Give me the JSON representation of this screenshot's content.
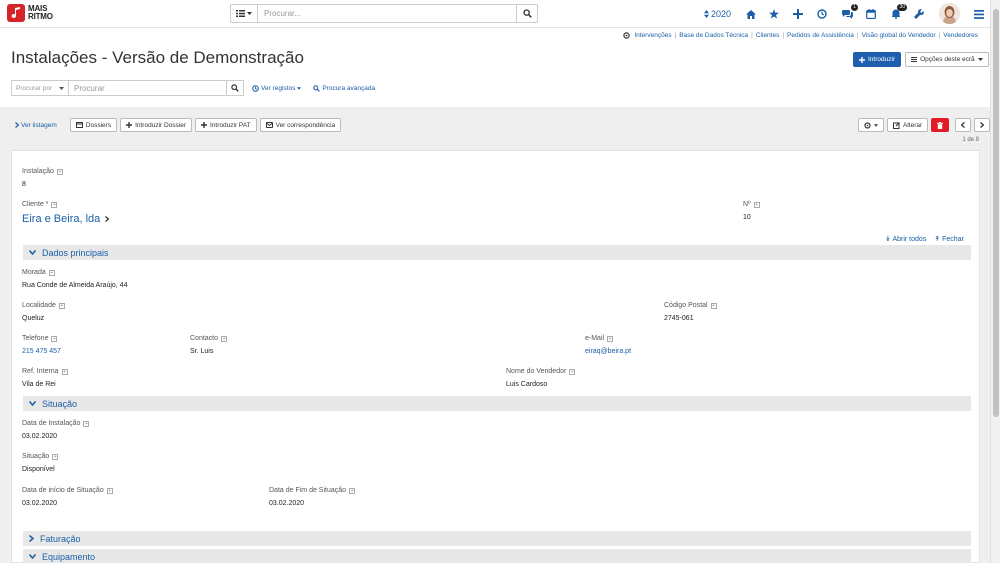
{
  "app": {
    "logo_line1": "MAIS",
    "logo_line2": "RITMO"
  },
  "search": {
    "placeholder": "Procurar..."
  },
  "topbar": {
    "year": "2020",
    "badge_support": "1",
    "badge_notifications": "30"
  },
  "quicklinks": [
    "Intervenções",
    "Base de Dados Técnica",
    "Clientes",
    "Pedidos de Assistência",
    "Visão global do Vendedor",
    "Vendedores"
  ],
  "page": {
    "title": "Instalações - Versão de Demonstração",
    "introduce_label": "Introduzir",
    "options_label": "Opções deste ecrã"
  },
  "filter": {
    "search_by": "Procurar por",
    "placeholder": "Procurar",
    "view_records": "Ver registos",
    "advanced": "Procura avançada"
  },
  "toolbar": {
    "view_list": "Ver listagem",
    "dossiers": "Dossiers",
    "add_dossier": "Introduzir Dossier",
    "add_pat": "Introduzir PAT",
    "view_correspondence": "Ver correspondência",
    "edit": "Alterar",
    "pager": "1 de 8"
  },
  "record": {
    "installation_label": "Instalação",
    "installation": "8",
    "client_label": "Cliente *",
    "client": "Eira e Beira, lda",
    "no_label": "Nº",
    "no": "10",
    "open_all": "Abrir todos",
    "close": "Fechar"
  },
  "sections": {
    "main": "Dados principais",
    "situation": "Situação",
    "billing": "Faturação",
    "equipment": "Equipamento"
  },
  "main": {
    "address_label": "Morada",
    "address": "Rua Conde de Almeida Araújo, 44",
    "locality_label": "Localidade",
    "locality": "Queluz",
    "postal_label": "Código Postal",
    "postal": "2745-061",
    "phone_label": "Telefone",
    "phone": "215 475 457",
    "contact_label": "Contacto",
    "contact": "Sr. Luis",
    "email_label": "e-Mail",
    "email": "eiraq@beira.pt",
    "ref_label": "Ref. Interna",
    "ref": "Vila de Rei",
    "seller_label": "Nome do Vendedor",
    "seller": "Luis Cardoso"
  },
  "situation": {
    "install_date_label": "Data de Instalação",
    "install_date": "03.02.2020",
    "status_label": "Situação",
    "status": "Disponível",
    "start_label": "Data de início de Situação",
    "start": "03.02.2020",
    "end_label": "Data de Fim de Situação",
    "end": "03.02.2020"
  },
  "colors": {
    "accent": "#1a5fa8",
    "brand": "#d6252a",
    "danger": "#e11c24",
    "primary": "#1e5fae"
  }
}
